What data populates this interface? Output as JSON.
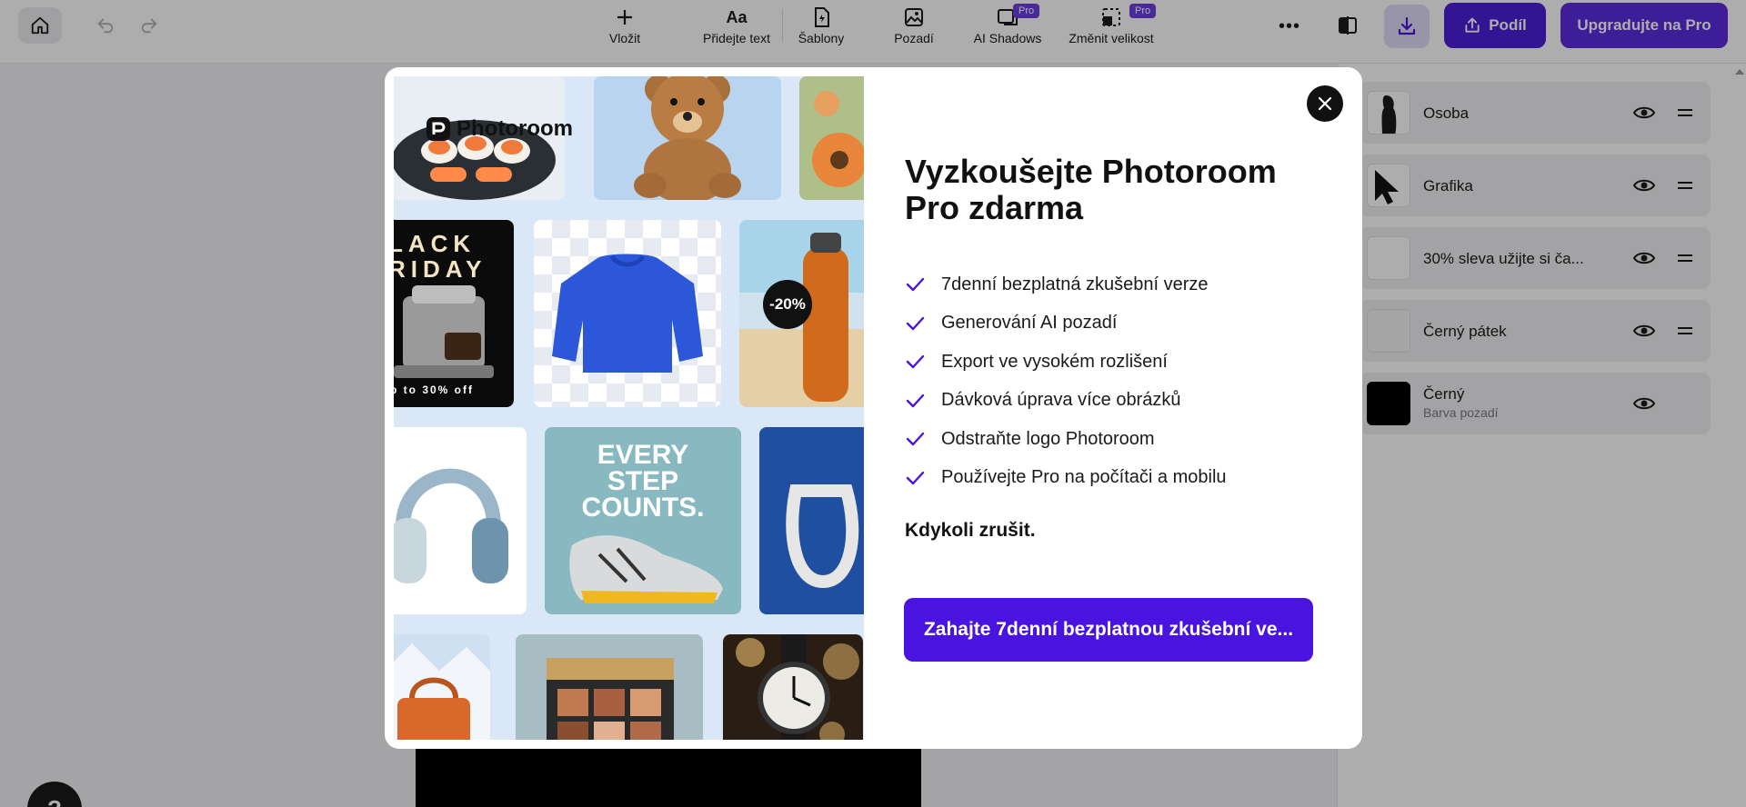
{
  "toolbar": {
    "tools": [
      {
        "label": "Vložit",
        "icon": "plus-icon"
      },
      {
        "label": "Přidejte text",
        "icon": "text-icon"
      },
      {
        "label": "Šablony",
        "icon": "templates-icon"
      },
      {
        "label": "Pozadí",
        "icon": "background-icon"
      },
      {
        "label": "AI Shadows",
        "icon": "ai-shadows-icon",
        "badge": "Pro"
      },
      {
        "label": "Změnit velikost",
        "icon": "resize-icon",
        "badge": "Pro"
      }
    ],
    "share_label": "Podíl",
    "upgrade_label": "Upgradujte na Pro"
  },
  "layers": [
    {
      "name": "Osoba",
      "sub": ""
    },
    {
      "name": "Grafika",
      "sub": ""
    },
    {
      "name": "30% sleva užijte si ča...",
      "sub": ""
    },
    {
      "name": "Černý pátek",
      "sub": ""
    },
    {
      "name": "Černý",
      "sub": "Barva pozadí"
    }
  ],
  "modal": {
    "logo_text": "Photoroom",
    "title_line1": "Vyzkoušejte Photoroom",
    "title_line2": "Pro zdarma",
    "features": [
      "7denní bezplatná zkušební verze",
      "Generování AI pozadí",
      "Export ve vysokém rozlišení",
      "Dávková úprava více obrázků",
      "Odstraňte logo Photoroom",
      "Používejte Pro na počítači a mobilu"
    ],
    "cancel_note": "Kdykoli zrušit.",
    "cta_label": "Zahajte 7denní bezplatnou zkušební ve...",
    "collage": {
      "black_friday_line1": "LACK",
      "black_friday_line2": "RIDAY",
      "black_friday_caption": "p to 30% off",
      "discount_badge": "-20%",
      "shoe_slogan_1": "EVERY",
      "shoe_slogan_2": "STEP",
      "shoe_slogan_3": "COUNTS."
    }
  },
  "colors": {
    "accent": "#4a14e0",
    "pro_badge": "#6b3fe0",
    "check": "#4a14e0"
  }
}
